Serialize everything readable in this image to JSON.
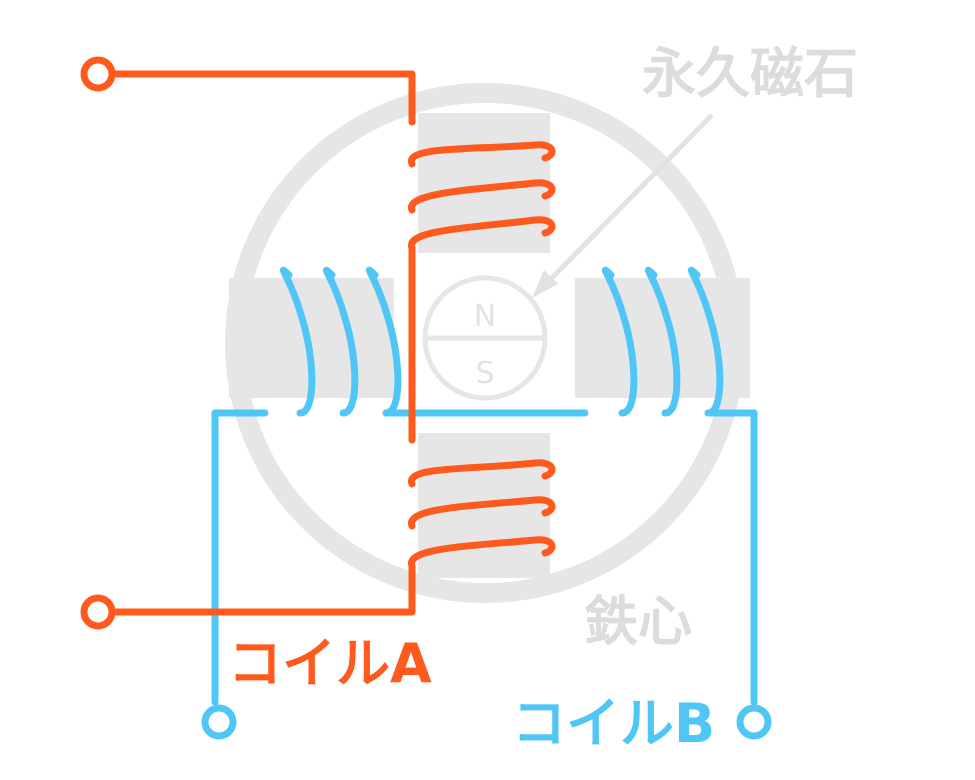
{
  "labels": {
    "permanent_magnet": "永久磁石",
    "iron_core": "鉄心",
    "coil_a": "コイルA",
    "coil_b": "コイルB",
    "rotor_north": "N",
    "rotor_south": "S"
  },
  "colors": {
    "coil_a": "#ff5a1e",
    "coil_b": "#4fc6f6",
    "core": "#e6e6e6",
    "annotation_text": "#dcdcdc",
    "background": "#ffffff"
  }
}
